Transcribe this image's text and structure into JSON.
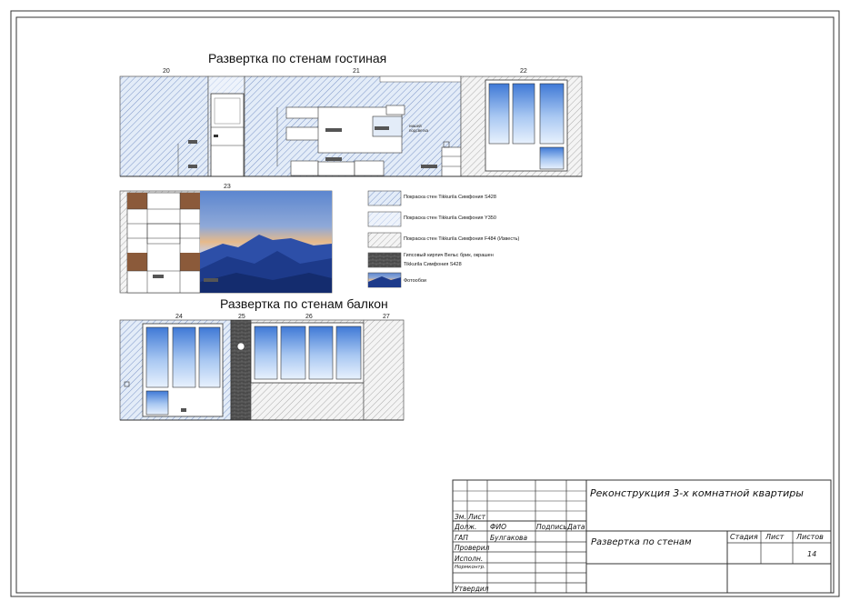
{
  "sheet": {
    "title_living": "Развертка по стенам гостиная",
    "title_balcony": "Развертка по стенам балкон",
    "wall_numbers_top": [
      "20",
      "21",
      "22"
    ],
    "wall_number_photo": "23",
    "wall_numbers_bottom": [
      "24",
      "25",
      "26",
      "27"
    ],
    "tv_label_line1": "нишей",
    "tv_label_line2": "подсветка"
  },
  "legend": {
    "items": [
      {
        "text": "Покраска стен Tikkurila Симфония S428"
      },
      {
        "text": "Покраска стен Tikkurila Симфония Y350"
      },
      {
        "text": "Покраска стен Tikkurila Симфония F484 (Известь)"
      },
      {
        "text": "Гипсовый кирпич Вельс брик, окрашен",
        "text2": "Tikkurila Симфония S428"
      },
      {
        "text": "Фотообои"
      }
    ],
    "colors": {
      "s428": "#7d96c8",
      "y350": "#b9cbea",
      "f484": "#9a9a9a",
      "brick": "#444444"
    }
  },
  "title_block": {
    "project": "Реконструкция 3-х комнатной квартиры",
    "sheet_name": "Развертка по стенам",
    "col_stage": "Стадия",
    "col_sheet": "Лист",
    "col_sheets": "Листов",
    "sheets_value": "14",
    "izm": "Зм.",
    "list": "Лист",
    "dolzh": "Долж.",
    "fio": "ФИО",
    "podpis": "Подпись",
    "data": "Дата",
    "gap": "ГАП",
    "gap_name": "Булгакова",
    "proveril": "Проверил",
    "ispolnil": "Исполн.",
    "normkontr": "Нормконтр.",
    "utverdil": "Утвердил"
  }
}
